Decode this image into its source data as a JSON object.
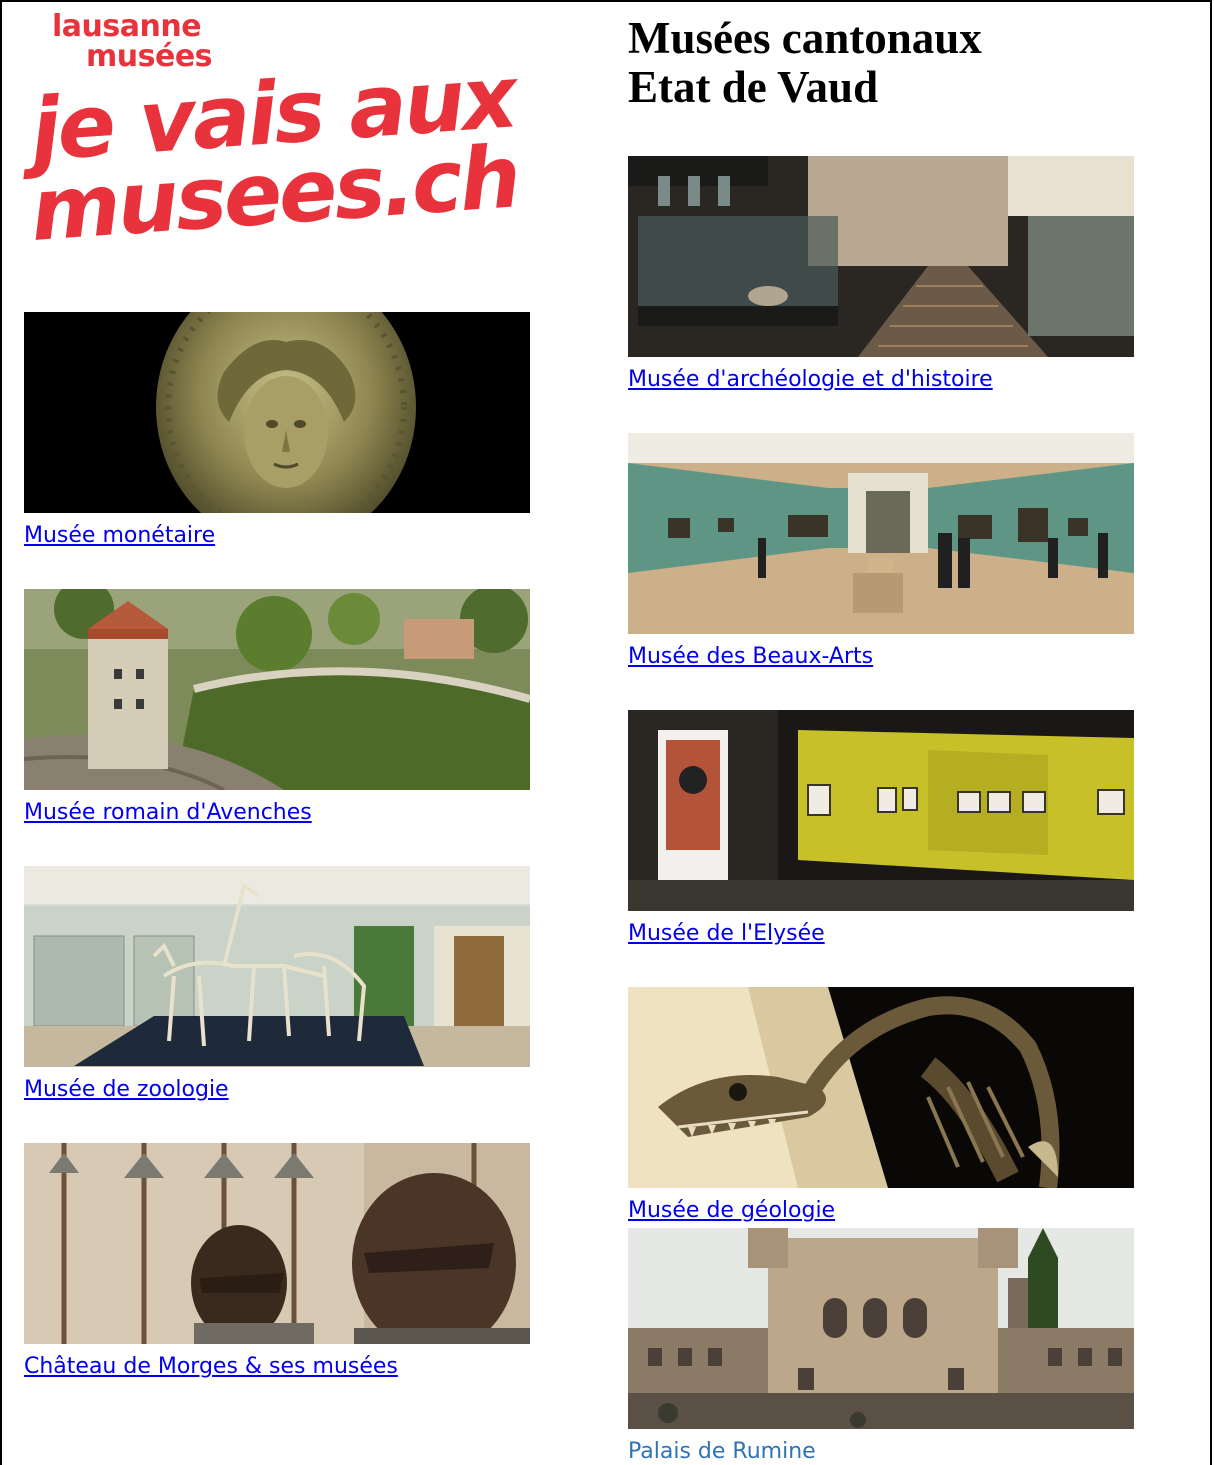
{
  "logo": {
    "line1": "lausanne",
    "line2": "musées",
    "line3": "je vais aux",
    "line4": "musees.ch",
    "color": "#e8323c"
  },
  "heading": {
    "line1": "Musées cantonaux",
    "line2": "Etat de Vaud"
  },
  "left_column": [
    {
      "label": "Musée monétaire",
      "image": "coin-photo"
    },
    {
      "label": "Musée romain d'Avenches",
      "image": "amphitheatre-photo"
    },
    {
      "label": "Musée de zoologie",
      "image": "skeletons-photo"
    },
    {
      "label": "Château de Morges & ses musées",
      "image": "armor-photo"
    }
  ],
  "right_column": [
    {
      "label": "Musée d'archéologie et d'histoire",
      "image": "archaeology-gallery-photo"
    },
    {
      "label": "Musée des Beaux-Arts",
      "image": "fine-arts-gallery-photo"
    },
    {
      "label": "Musée de l'Elysée",
      "image": "photo-exhibition-photo"
    },
    {
      "label": "Musée de géologie",
      "image": "dinosaur-skeleton-photo"
    },
    {
      "label": "Palais de Rumine",
      "image": "palace-facade-photo"
    }
  ],
  "colors": {
    "link": "#0000ee",
    "plain_link": "#2e74b5",
    "brand_red": "#e8323c"
  }
}
